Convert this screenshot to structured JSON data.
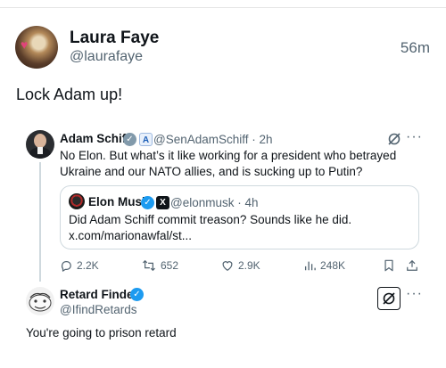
{
  "outer": {
    "name": "Laura Faye",
    "handle": "@laurafaye",
    "time": "56m",
    "text": "Lock Adam up!"
  },
  "quote_post": {
    "name": "Adam Schiff",
    "handle_time": "@SenAdamSchiff · 2h",
    "text": "No Elon. But what’s it like working for a president who betrayed Ukraine and our NATO allies, and is sucking up to Putin?",
    "more": "···",
    "actions": {
      "replies": "2.2K",
      "reposts": "652",
      "likes": "2.9K",
      "views": "248K"
    }
  },
  "nested_quote": {
    "name": "Elon Musk",
    "handle_time": "@elonmusk · 4h",
    "line1": "Did Adam Schiff commit treason? Sounds like he did.",
    "line2": "x.com/marionawfal/st..."
  },
  "reply": {
    "name": "Retard Finder",
    "handle": "@IfindRetards",
    "text": "You're going to prison retard",
    "more": "···"
  },
  "colors": {
    "verified_blue": "#1d9bf0",
    "verified_grey": "#829aab",
    "text_primary": "#0f1419",
    "text_secondary": "#536471",
    "border": "#cfd9de"
  }
}
